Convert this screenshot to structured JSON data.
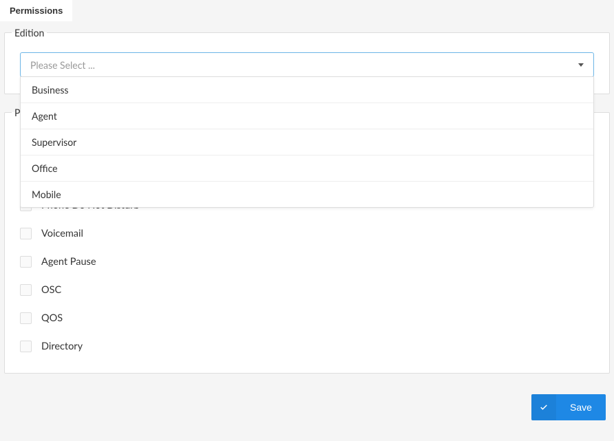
{
  "tab": {
    "permissions": "Permissions"
  },
  "sections": {
    "edition_legend": "Edition",
    "permissions_legend": "Permissions"
  },
  "edition_select": {
    "placeholder": "Please Select ...",
    "options": [
      {
        "label": "Business"
      },
      {
        "label": "Agent"
      },
      {
        "label": "Supervisor"
      },
      {
        "label": "Office"
      },
      {
        "label": "Mobile"
      }
    ]
  },
  "permission_items": [
    {
      "label": "Phone Do Not Disturb"
    },
    {
      "label": "Voicemail"
    },
    {
      "label": "Agent Pause"
    },
    {
      "label": "OSC"
    },
    {
      "label": "QOS"
    },
    {
      "label": "Directory"
    }
  ],
  "buttons": {
    "save": "Save"
  }
}
